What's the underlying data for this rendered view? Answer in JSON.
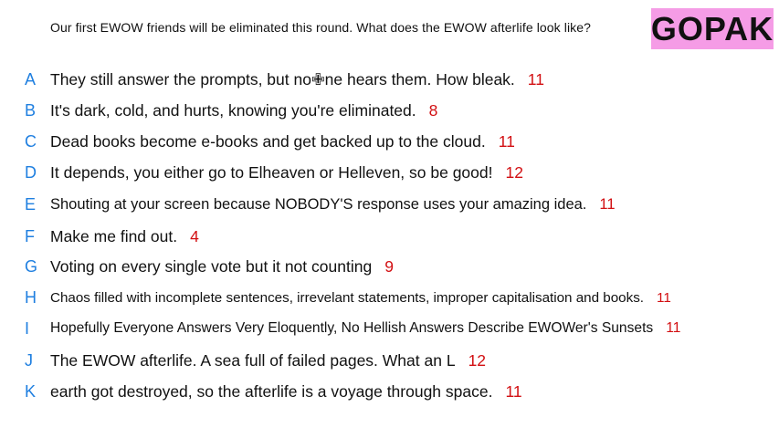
{
  "prompt": "Our first EWOW friends will be eliminated this round. What does the EWOW afterlife look like?",
  "badge": "GOPAK",
  "colors": {
    "letter": "#1f7fe0",
    "count": "#d20f12",
    "badge_bg": "#f59ce6"
  },
  "responses": [
    {
      "letter": "A",
      "text": "They still answer the prompts, but no✙ne hears them. How bleak.",
      "count": "11"
    },
    {
      "letter": "B",
      "text": "It's dark, cold, and hurts, knowing you're eliminated.",
      "count": "8"
    },
    {
      "letter": "C",
      "text": "Dead books become e-books and get backed up to the cloud.",
      "count": "11"
    },
    {
      "letter": "D",
      "text": "It depends, you either go to Elheaven or Helleven, so be good!",
      "count": "12"
    },
    {
      "letter": "E",
      "text": "Shouting at your screen because NOBODY'S response uses your amazing idea.",
      "count": "11"
    },
    {
      "letter": "F",
      "text": "Make me find out.",
      "count": "4"
    },
    {
      "letter": "G",
      "text": "Voting on every single vote but it not counting",
      "count": "9"
    },
    {
      "letter": "H",
      "text": "Chaos filled with incomplete sentences, irrevelant statements, improper capitalisation and books.",
      "count": "11"
    },
    {
      "letter": "I",
      "text": "Hopefully Everyone Answers Very Eloquently, No Hellish Answers Describe EWOWer's Sunsets",
      "count": "11"
    },
    {
      "letter": "J",
      "text": "The EWOW afterlife. A sea full of failed pages. What an L",
      "count": "12"
    },
    {
      "letter": "K",
      "text": "earth got destroyed, so the afterlife is a voyage through space.",
      "count": "11"
    }
  ]
}
